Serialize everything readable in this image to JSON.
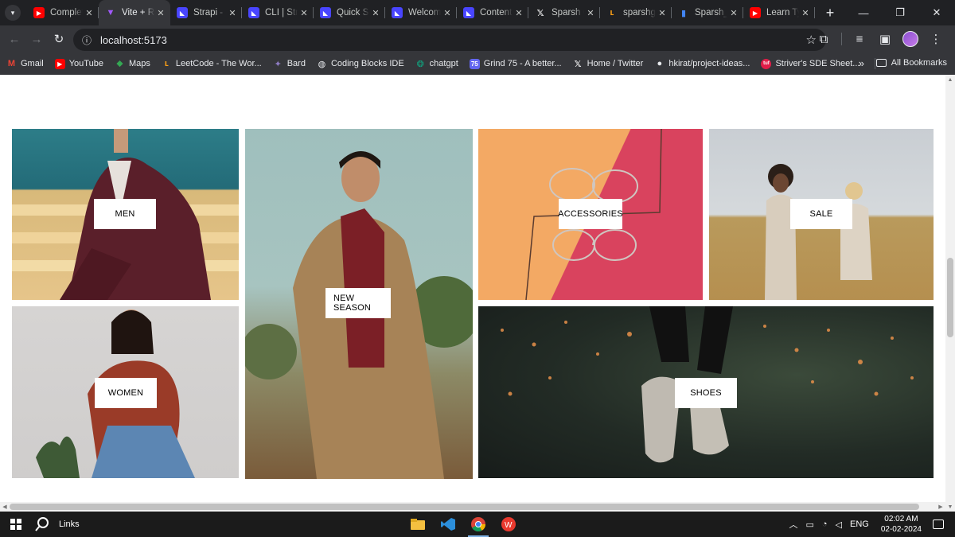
{
  "browser": {
    "tabs": [
      {
        "title": "Complete",
        "favicon": "youtube-icon",
        "color": "#ff0000",
        "active": false
      },
      {
        "title": "Vite + React",
        "favicon": "vite-icon",
        "color": "#a259ff",
        "active": true
      },
      {
        "title": "Strapi - C",
        "favicon": "strapi-icon",
        "color": "#4945ff",
        "active": false
      },
      {
        "title": "CLI | Strapi",
        "favicon": "strapi-icon",
        "color": "#4945ff",
        "active": false
      },
      {
        "title": "Quick Start",
        "favicon": "strapi-icon",
        "color": "#4945ff",
        "active": false
      },
      {
        "title": "Welcome",
        "favicon": "strapi-icon",
        "color": "#4945ff",
        "active": false
      },
      {
        "title": "Content",
        "favicon": "strapi-icon",
        "color": "#4945ff",
        "active": false
      },
      {
        "title": "Sparsh G",
        "favicon": "x-icon",
        "color": "#000000",
        "active": false
      },
      {
        "title": "sparshg",
        "favicon": "leetcode-icon",
        "color": "#ffa116",
        "active": false
      },
      {
        "title": "Sparsh_g",
        "favicon": "chart-icon",
        "color": "#4285f4",
        "active": false
      },
      {
        "title": "Learn Ty",
        "favicon": "youtube-icon",
        "color": "#ff0000",
        "active": false
      }
    ],
    "address": "localhost:5173",
    "bookmarks": [
      {
        "label": "Gmail",
        "icon": "gmail-icon",
        "color": "#ea4335"
      },
      {
        "label": "YouTube",
        "icon": "youtube-icon",
        "color": "#ff0000"
      },
      {
        "label": "Maps",
        "icon": "maps-icon",
        "color": "#34a853"
      },
      {
        "label": "LeetCode - The Wor...",
        "icon": "leetcode-icon",
        "color": "#ffa116"
      },
      {
        "label": "Bard",
        "icon": "bard-icon",
        "color": "#8e7cc3"
      },
      {
        "label": "Coding Blocks IDE",
        "icon": "globe-icon",
        "color": "#5f6368"
      },
      {
        "label": "chatgpt",
        "icon": "chatgpt-icon",
        "color": "#10a37f"
      },
      {
        "label": "Grind 75 - A better...",
        "icon": "grind-icon",
        "color": "#6366f1"
      },
      {
        "label": "Home / Twitter",
        "icon": "x-icon",
        "color": "#000000"
      },
      {
        "label": "hkirat/project-ideas...",
        "icon": "github-icon",
        "color": "#24292f"
      },
      {
        "label": "Striver's SDE Sheet...",
        "icon": "tuf-icon",
        "color": "#e11d48"
      }
    ],
    "all_bookmarks_label": "All Bookmarks"
  },
  "page": {
    "categories": [
      {
        "id": "men",
        "label": "MEN"
      },
      {
        "id": "new-season",
        "label": "NEW SEASON"
      },
      {
        "id": "accessories",
        "label": "ACCESSORIES"
      },
      {
        "id": "sale",
        "label": "SALE"
      },
      {
        "id": "women",
        "label": "WOMEN"
      },
      {
        "id": "shoes",
        "label": "SHOES"
      }
    ]
  },
  "taskbar": {
    "search_label": "Links",
    "language": "ENG",
    "time": "02:02 AM",
    "date": "02-02-2024"
  },
  "colors": {
    "chrome_dark": "#202124",
    "chrome_toolbar": "#35363a",
    "page_bg": "#ffffff",
    "label_bg": "#ffffff"
  }
}
